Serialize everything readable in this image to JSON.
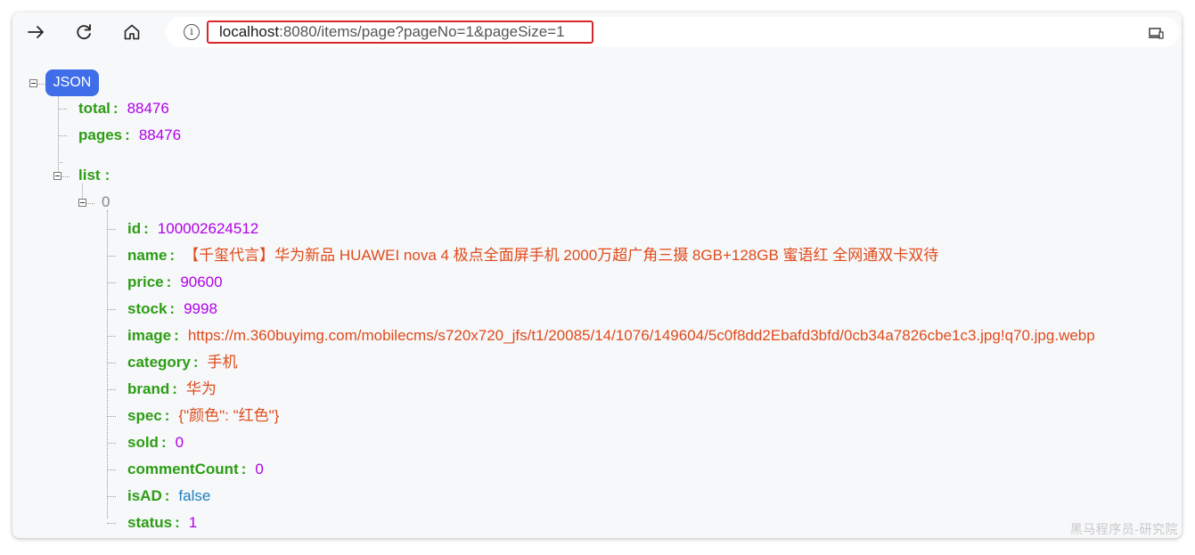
{
  "browser": {
    "url_host": "localhost",
    "url_rest": ":8080/items/page?pageNo=1&pageSize=1",
    "icons": [
      "back-arrow-icon",
      "reload-icon",
      "home-icon",
      "info-icon",
      "device-icon"
    ]
  },
  "viewer": {
    "root_label": "JSON",
    "root": [
      {
        "key": "total",
        "value": "88476",
        "type": "number"
      },
      {
        "key": "pages",
        "value": "88476",
        "type": "number"
      },
      {
        "key": "list",
        "type": "array"
      }
    ],
    "list_index": "0",
    "item": [
      {
        "key": "id",
        "value": "100002624512",
        "type": "number"
      },
      {
        "key": "name",
        "value": "【千玺代言】华为新品 HUAWEI nova 4 极点全面屏手机 2000万超广角三摄 8GB+128GB 蜜语红 全网通双卡双待",
        "type": "string"
      },
      {
        "key": "price",
        "value": "90600",
        "type": "number"
      },
      {
        "key": "stock",
        "value": "9998",
        "type": "number"
      },
      {
        "key": "image",
        "value": "https://m.360buyimg.com/mobilecms/s720x720_jfs/t1/20085/14/1076/149604/5c0f8dd2Ebafd3bfd/0cb34a7826cbe1c3.jpg!q70.jpg.webp",
        "type": "string"
      },
      {
        "key": "category",
        "value": "手机",
        "type": "string"
      },
      {
        "key": "brand",
        "value": "华为",
        "type": "string"
      },
      {
        "key": "spec",
        "value": "{\"颜色\": \"红色\"}",
        "type": "string"
      },
      {
        "key": "sold",
        "value": "0",
        "type": "number"
      },
      {
        "key": "commentCount",
        "value": "0",
        "type": "number"
      },
      {
        "key": "isAD",
        "value": "false",
        "type": "boolean"
      },
      {
        "key": "status",
        "value": "1",
        "type": "number"
      }
    ]
  },
  "watermark": "黑马程序员-研究院",
  "colors": {
    "key": "#2c9d14",
    "number": "#b000e6",
    "string": "#e04b1b",
    "boolean": "#1f7fc0",
    "badge": "#3f6ee8",
    "highlight": "#d9262a"
  }
}
